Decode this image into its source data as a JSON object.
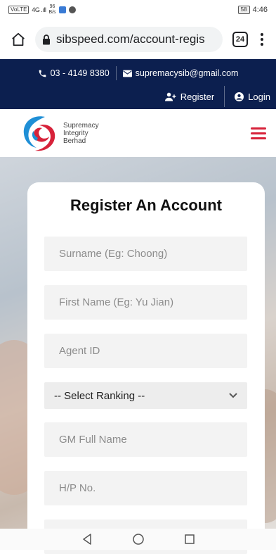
{
  "status_bar": {
    "network": "VoLTE",
    "signal": "4G .ıll",
    "speed_value": "96",
    "speed_unit": "B/s",
    "battery": "58",
    "time": "4:46"
  },
  "browser": {
    "url": "sibspeed.com/account-regis",
    "tab_count": "24"
  },
  "topbar": {
    "phone": "03 - 4149 8380",
    "email": "supremacysib@gmail.com",
    "register_label": "Register",
    "login_label": "Login"
  },
  "logo": {
    "line1": "Supremacy",
    "line2": "Integrity",
    "line3": "Berhad"
  },
  "colors": {
    "navy": "#0c1f4f",
    "accent_red": "#d7223a",
    "logo_blue": "#1f8fd6"
  },
  "form": {
    "title": "Register An Account",
    "surname_placeholder": "Surname (Eg: Choong)",
    "firstname_placeholder": "First Name (Eg: Yu Jian)",
    "agent_placeholder": "Agent ID",
    "ranking_selected": "-- Select Ranking --",
    "gm_placeholder": "GM Full Name",
    "phone_placeholder": "H/P No."
  },
  "icons": [
    "home-icon",
    "lock-icon",
    "tabs-icon",
    "more-vert-icon",
    "phone-icon",
    "mail-icon",
    "user-plus-icon",
    "user-icon",
    "menu-icon",
    "chevron-down-icon",
    "back-icon",
    "home-nav-icon",
    "recents-icon"
  ]
}
